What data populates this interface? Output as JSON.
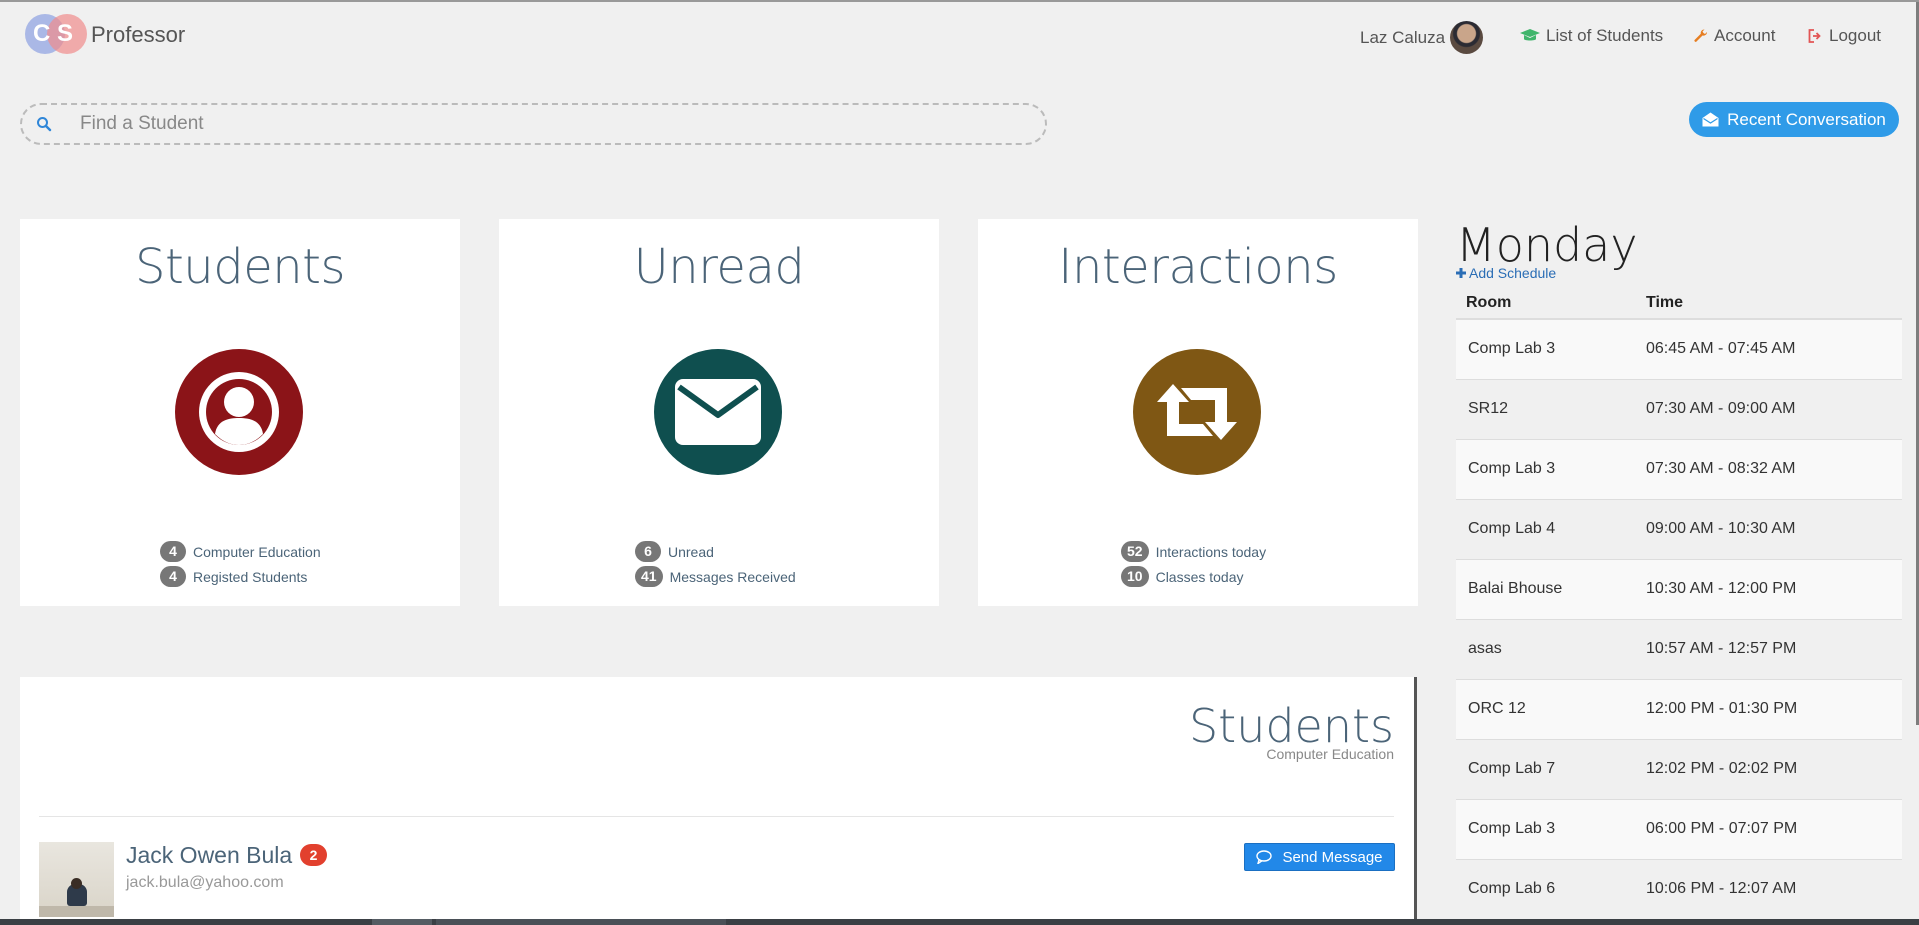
{
  "header": {
    "logo": {
      "letter1": "C",
      "letter2": "S"
    },
    "app_title": "Professor",
    "user_name": "Laz Caluza",
    "nav": {
      "students_label": "List of Students",
      "account_label": "Account",
      "logout_label": "Logout"
    }
  },
  "search": {
    "placeholder": "Find a Student",
    "value": ""
  },
  "recent_button": {
    "label": "Recent Conversation"
  },
  "cards": [
    {
      "title": "Students",
      "icon": "user-circle-icon",
      "color": "#8b1418",
      "stats": [
        {
          "count": "4",
          "label": "Computer Education"
        },
        {
          "count": "4",
          "label": "Registed Students"
        }
      ]
    },
    {
      "title": "Unread",
      "icon": "envelope-icon",
      "color": "#0f4f4f",
      "stats": [
        {
          "count": "6",
          "label": "Unread"
        },
        {
          "count": "41",
          "label": "Messages Received"
        }
      ]
    },
    {
      "title": "Interactions",
      "icon": "retweet-icon",
      "color": "#7f5714",
      "stats": [
        {
          "count": "52",
          "label": "Interactions today"
        },
        {
          "count": "10",
          "label": "Classes today"
        }
      ]
    }
  ],
  "schedule": {
    "day": "Monday",
    "add_label": "Add Schedule",
    "columns": [
      "Room",
      "Time"
    ],
    "rows": [
      {
        "room": "Comp Lab 3",
        "time": "06:45 AM - 07:45 AM"
      },
      {
        "room": "SR12",
        "time": "07:30 AM - 09:00 AM"
      },
      {
        "room": "Comp Lab 3",
        "time": "07:30 AM - 08:32 AM"
      },
      {
        "room": "Comp Lab 4",
        "time": "09:00 AM - 10:30 AM"
      },
      {
        "room": "Balai Bhouse",
        "time": "10:30 AM - 12:00 PM"
      },
      {
        "room": "asas",
        "time": "10:57 AM - 12:57 PM"
      },
      {
        "room": "ORC 12",
        "time": "12:00 PM - 01:30 PM"
      },
      {
        "room": "Comp Lab 7",
        "time": "12:02 PM - 02:02 PM"
      },
      {
        "room": "Comp Lab 3",
        "time": "06:00 PM - 07:07 PM"
      },
      {
        "room": "Comp Lab 6",
        "time": "10:06 PM - 12:07 AM"
      }
    ]
  },
  "students_panel": {
    "title": "Students",
    "subtitle": "Computer Education",
    "students": [
      {
        "name": "Jack Owen Bula",
        "badge": "2",
        "email": "jack.bula@yahoo.com",
        "button_label": "Send Message"
      }
    ]
  }
}
